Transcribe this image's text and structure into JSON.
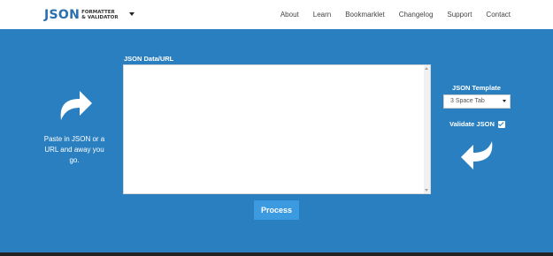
{
  "header": {
    "logo_main": "JSON",
    "logo_line1": "FORMATTER",
    "logo_line2": "& VALIDATOR",
    "nav": [
      "About",
      "Learn",
      "Bookmarklet",
      "Changelog",
      "Support",
      "Contact"
    ]
  },
  "left_hint": {
    "icon": "curved-arrow-right-icon",
    "text": "Paste in JSON or a URL and away you go."
  },
  "input": {
    "label": "JSON Data/URL",
    "value": "",
    "placeholder": ""
  },
  "process_label": "Process",
  "template": {
    "label": "JSON Template",
    "selected": "3 Space Tab"
  },
  "validate": {
    "label": "Validate JSON",
    "checked": true
  },
  "right_icon": "curved-arrow-left-icon",
  "colors": {
    "background": "#2a7fc0",
    "button": "#3c9ae0",
    "logo": "#2a6fb0"
  }
}
